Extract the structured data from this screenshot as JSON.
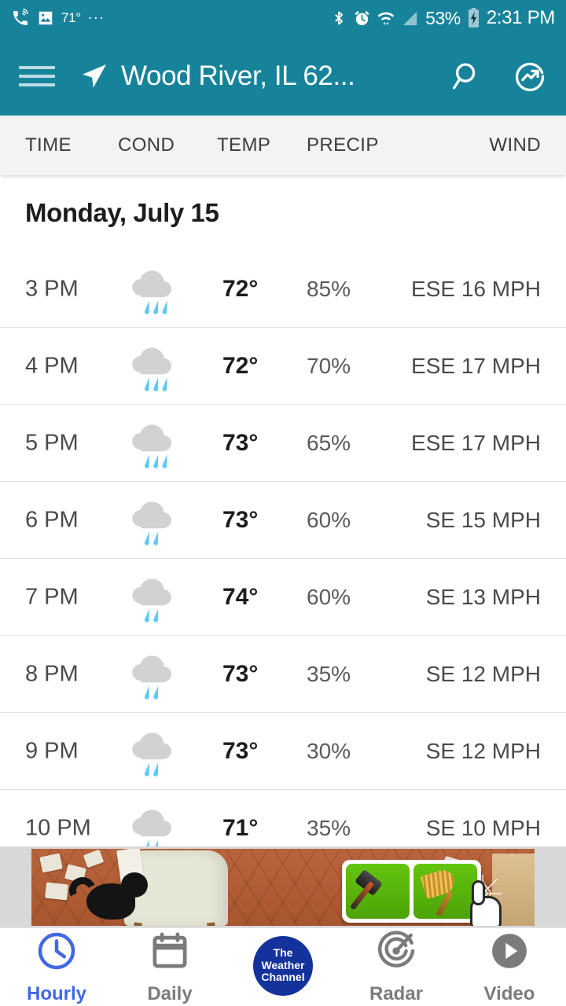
{
  "status_bar": {
    "left_icons": [
      "phone-ringing-icon",
      "image-icon"
    ],
    "temperature": "71°",
    "overflow": "...",
    "right_icons": [
      "bluetooth-icon",
      "alarm-icon",
      "wifi-icon",
      "cellular-signal-icon"
    ],
    "battery_percent": "53%",
    "battery_state": "charging",
    "clock": "2:31 PM"
  },
  "app_bar": {
    "menu_icon": "hamburger-menu-icon",
    "location_icon": "navigation-arrow-icon",
    "location": "Wood River, IL 62...",
    "search_icon": "search-icon",
    "trending_icon": "trending-circle-icon"
  },
  "columns": {
    "time": "TIME",
    "cond": "COND",
    "temp": "TEMP",
    "precip": "PRECIP",
    "wind": "WIND"
  },
  "day_header": "Monday, July 15",
  "hours": [
    {
      "time": "3 PM",
      "cond": "rain-cloud-icon",
      "drops": 3,
      "temp": "72°",
      "precip": "85%",
      "wind": "ESE 16 MPH"
    },
    {
      "time": "4 PM",
      "cond": "rain-cloud-icon",
      "drops": 3,
      "temp": "72°",
      "precip": "70%",
      "wind": "ESE 17 MPH"
    },
    {
      "time": "5 PM",
      "cond": "rain-cloud-icon",
      "drops": 3,
      "temp": "73°",
      "precip": "65%",
      "wind": "ESE 17 MPH"
    },
    {
      "time": "6 PM",
      "cond": "rain-cloud-icon",
      "drops": 2,
      "temp": "73°",
      "precip": "60%",
      "wind": "SE 15 MPH"
    },
    {
      "time": "7 PM",
      "cond": "rain-cloud-icon",
      "drops": 2,
      "temp": "74°",
      "precip": "60%",
      "wind": "SE 13 MPH"
    },
    {
      "time": "8 PM",
      "cond": "rain-cloud-icon",
      "drops": 2,
      "temp": "73°",
      "precip": "35%",
      "wind": "SE 12 MPH"
    },
    {
      "time": "9 PM",
      "cond": "rain-cloud-icon",
      "drops": 2,
      "temp": "73°",
      "precip": "30%",
      "wind": "SE 12 MPH"
    },
    {
      "time": "10 PM",
      "cond": "rain-cloud-icon",
      "drops": 2,
      "temp": "71°",
      "precip": "35%",
      "wind": "SE 10 MPH"
    }
  ],
  "ad": {
    "description": "game-advertisement-banner",
    "tiles": [
      "hammer-tool-icon",
      "broom-tool-icon"
    ],
    "pointer": "pointing-hand-icon"
  },
  "bottom_nav": [
    {
      "label": "Hourly",
      "icon": "clock-icon",
      "active": true
    },
    {
      "label": "Daily",
      "icon": "calendar-icon",
      "active": false
    },
    {
      "label": "",
      "icon": "weather-channel-logo",
      "active": false,
      "logo_lines": [
        "The",
        "Weather",
        "Channel"
      ]
    },
    {
      "label": "Radar",
      "icon": "radar-icon",
      "active": false
    },
    {
      "label": "Video",
      "icon": "play-circle-icon",
      "active": false
    }
  ],
  "colors": {
    "header_teal": "#17839B",
    "accent_blue": "#4169E1",
    "twc_navy": "#14329B",
    "raindrop_blue": "#5BCBF5",
    "cloud_gray": "#D2D2D2"
  }
}
